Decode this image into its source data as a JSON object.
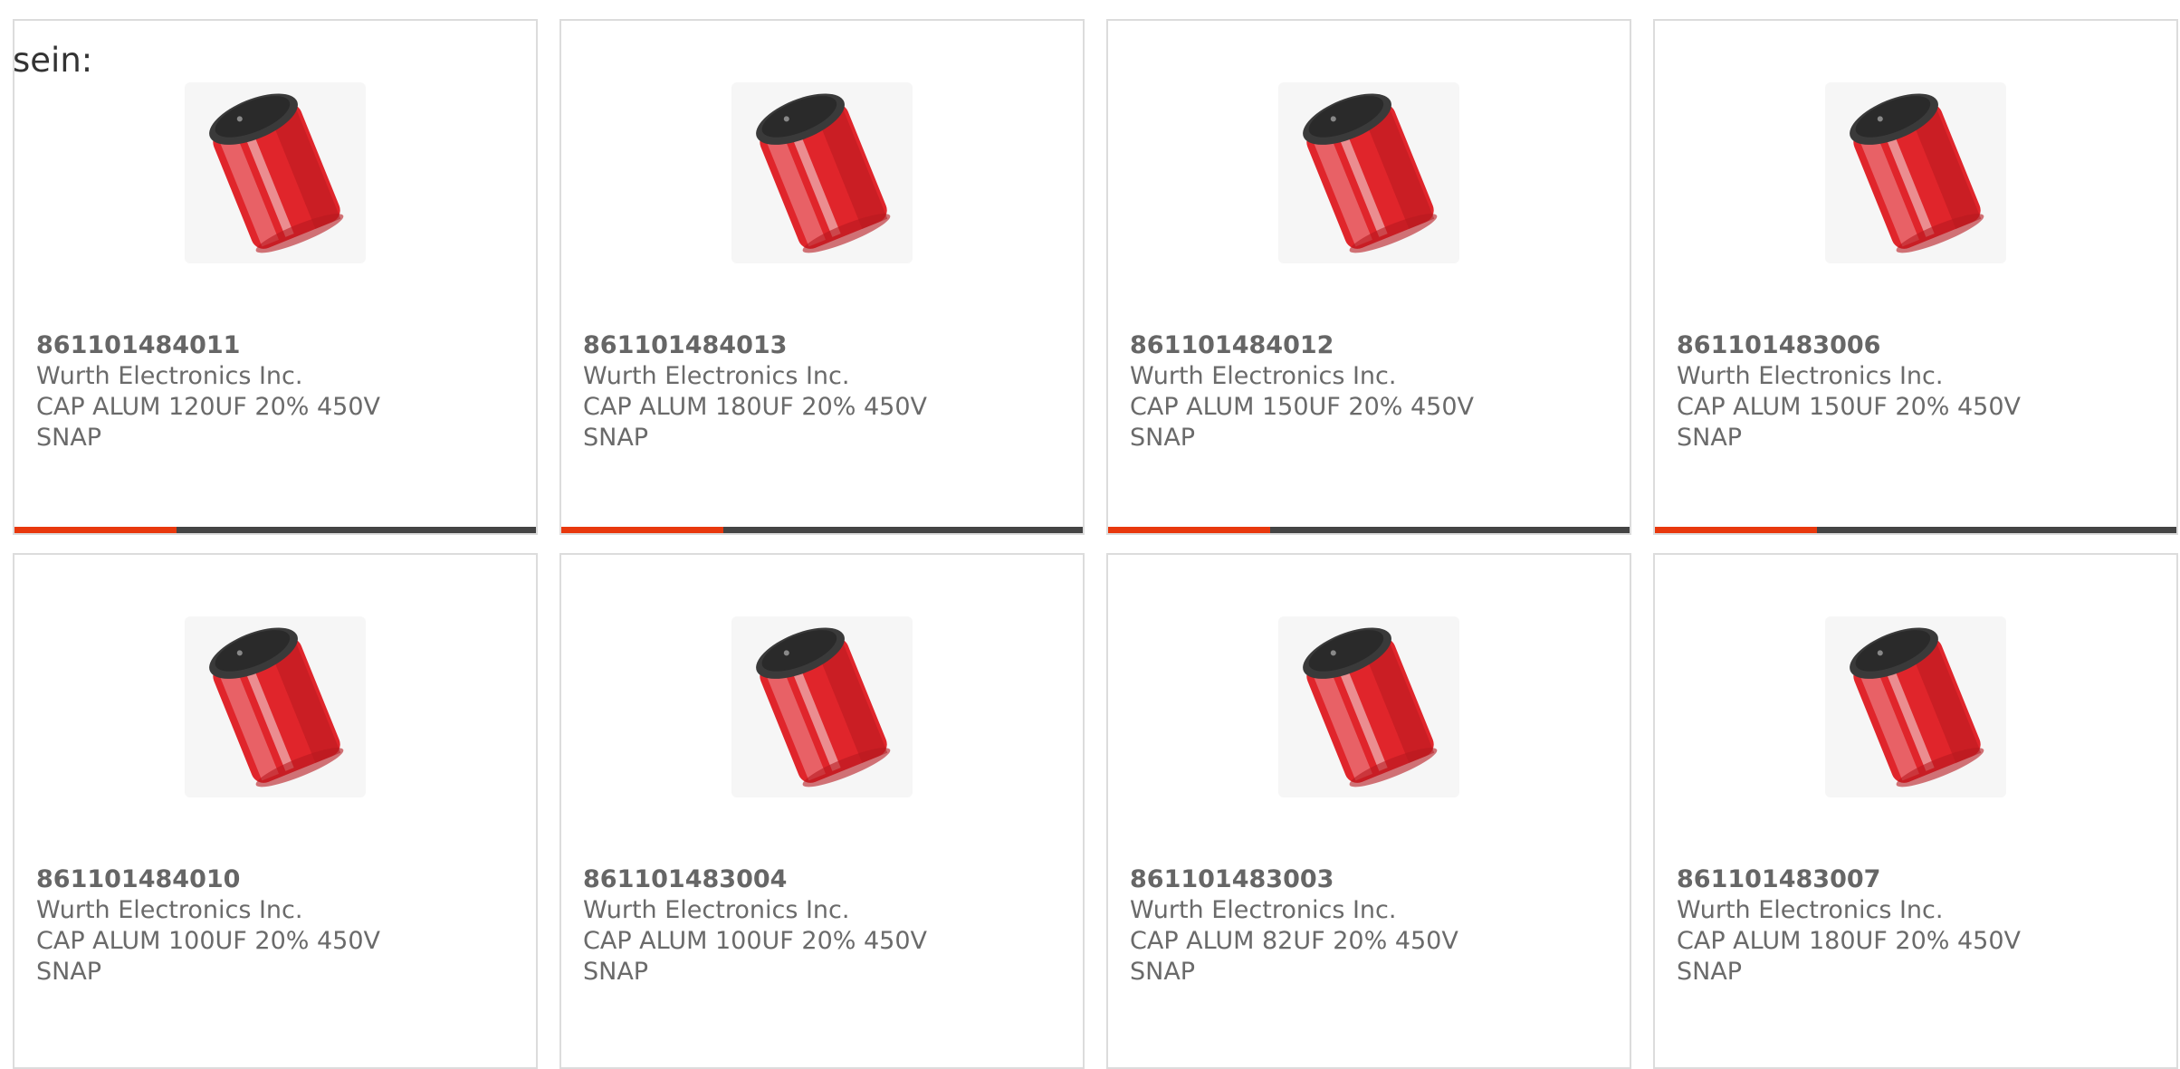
{
  "intro_text": "sein:",
  "colors": {
    "card_border": "#dcdcdc",
    "text": "#6a6a6a",
    "accent": "#e8380d",
    "bar_track": "#444444",
    "capacitor_body": "#e0252b",
    "capacitor_top": "#3a3a3a"
  },
  "products": [
    {
      "part_number": "861101484011",
      "manufacturer": "Wurth Electronics Inc.",
      "description": "CAP ALUM 120UF 20% 450V SNAP",
      "image": "red-snap-in-capacitor-image",
      "progress": 0.31
    },
    {
      "part_number": "861101484013",
      "manufacturer": "Wurth Electronics Inc.",
      "description": "CAP ALUM 180UF 20% 450V SNAP",
      "image": "red-snap-in-capacitor-image",
      "progress": 0.31
    },
    {
      "part_number": "861101484012",
      "manufacturer": "Wurth Electronics Inc.",
      "description": "CAP ALUM 150UF 20% 450V SNAP",
      "image": "red-snap-in-capacitor-image",
      "progress": 0.31
    },
    {
      "part_number": "861101483006",
      "manufacturer": "Wurth Electronics Inc.",
      "description": "CAP ALUM 150UF 20% 450V SNAP",
      "image": "red-snap-in-capacitor-image",
      "progress": 0.31
    },
    {
      "part_number": "861101484010",
      "manufacturer": "Wurth Electronics Inc.",
      "description": "CAP ALUM 100UF 20% 450V SNAP",
      "image": "red-snap-in-capacitor-image",
      "progress": 0.31
    },
    {
      "part_number": "861101483004",
      "manufacturer": "Wurth Electronics Inc.",
      "description": "CAP ALUM 100UF 20% 450V SNAP",
      "image": "red-snap-in-capacitor-image",
      "progress": 0.31
    },
    {
      "part_number": "861101483003",
      "manufacturer": "Wurth Electronics Inc.",
      "description": "CAP ALUM 82UF 20% 450V SNAP",
      "image": "red-snap-in-capacitor-image",
      "progress": 0.31
    },
    {
      "part_number": "861101483007",
      "manufacturer": "Wurth Electronics Inc.",
      "description": "CAP ALUM 180UF 20% 450V SNAP",
      "image": "red-snap-in-capacitor-image",
      "progress": 0.31
    }
  ]
}
